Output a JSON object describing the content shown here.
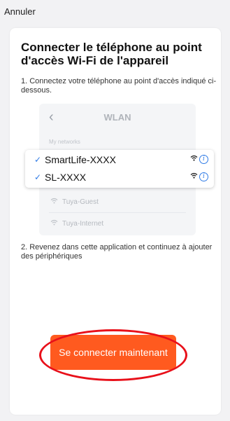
{
  "topbar": {
    "cancel_label": "Annuler"
  },
  "title": "Connecter le téléphone au point d'accès Wi-Fi de l'appareil",
  "step1": "1. Connectez votre téléphone au point d'accès indiqué ci-dessous.",
  "illustration": {
    "back_icon": "chevron-left",
    "header": "WLAN",
    "subhead": "My networks",
    "networks": [
      {
        "ssid": "SmartLife-XXXX",
        "checked": true
      },
      {
        "ssid": "SL-XXXX",
        "checked": true
      }
    ],
    "other_networks": [
      "Tuya-Guest",
      "Tuya-Internet"
    ]
  },
  "step2": "2. Revenez dans cette application et continuez à ajouter des périphériques",
  "connect_button": {
    "label": "Se connecter maintenant"
  },
  "colors": {
    "accent": "#ff5a1f",
    "highlight": "#e8101a",
    "check": "#2f7be6"
  }
}
